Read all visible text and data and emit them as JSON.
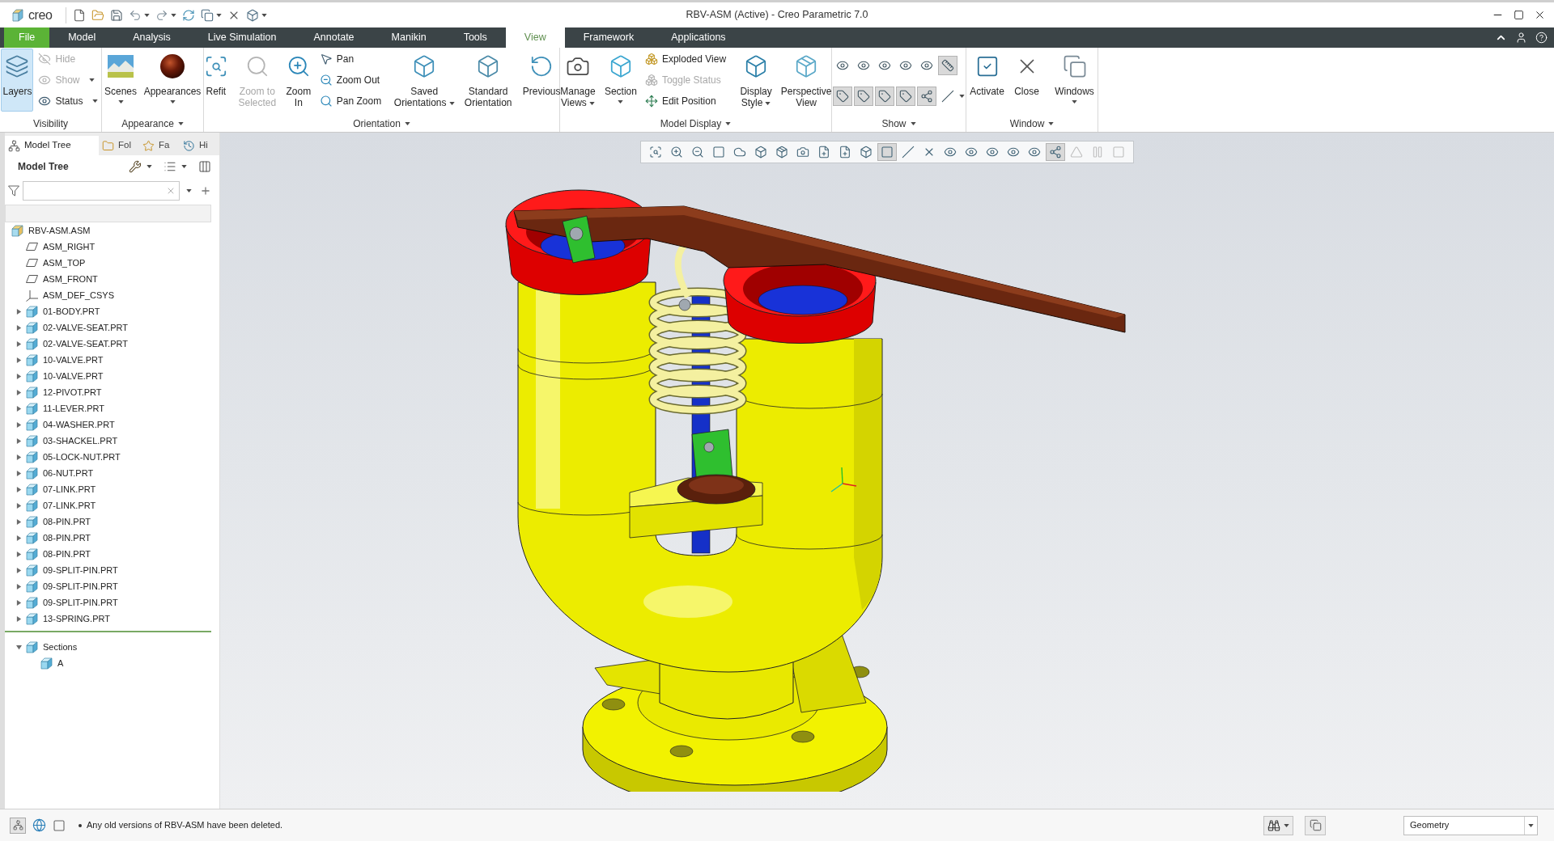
{
  "title_bar": {
    "logo": "creo",
    "title": "RBV-ASM (Active) - Creo Parametric 7.0"
  },
  "ribbon_tabs": [
    {
      "label": "File",
      "kind": "file",
      "selected": false
    },
    {
      "label": "Model",
      "kind": "tab",
      "selected": false
    },
    {
      "label": "Analysis",
      "kind": "tab",
      "selected": false
    },
    {
      "label": "Live Simulation",
      "kind": "tab",
      "selected": false
    },
    {
      "label": "Annotate",
      "kind": "tab",
      "selected": false
    },
    {
      "label": "Manikin",
      "kind": "tab",
      "selected": false
    },
    {
      "label": "Tools",
      "kind": "tab",
      "selected": false
    },
    {
      "label": "View",
      "kind": "tab",
      "selected": true
    },
    {
      "label": "Framework",
      "kind": "tab",
      "selected": false
    },
    {
      "label": "Applications",
      "kind": "tab",
      "selected": false
    }
  ],
  "ribbon_groups": [
    {
      "label": "Visibility",
      "menu": false,
      "buttons": [
        {
          "label": "Layers",
          "kind": "large",
          "on": true,
          "disabled": false,
          "dropdown": false
        },
        {
          "label": "Hide",
          "kind": "small",
          "on": false,
          "disabled": true,
          "dropdown": false
        },
        {
          "label": "Show",
          "kind": "small",
          "on": false,
          "disabled": true,
          "dropdown": true
        },
        {
          "label": "Status",
          "kind": "small",
          "on": false,
          "disabled": false,
          "dropdown": true
        }
      ]
    },
    {
      "label": "Appearance",
      "menu": true,
      "buttons": [
        {
          "label": "Scenes",
          "kind": "large",
          "on": false,
          "disabled": false,
          "dropdown": true
        },
        {
          "label": "Appearances",
          "kind": "large",
          "on": false,
          "disabled": false,
          "dropdown": true
        }
      ]
    },
    {
      "label": "Orientation",
      "menu": true,
      "buttons": [
        {
          "label": "Refit",
          "kind": "large",
          "on": false,
          "disabled": false,
          "dropdown": false
        },
        {
          "label": "Zoom to Selected",
          "kind": "large",
          "on": false,
          "disabled": true,
          "dropdown": false
        },
        {
          "label": "Zoom In",
          "kind": "large",
          "on": false,
          "disabled": false,
          "dropdown": false
        },
        {
          "label": "Pan",
          "kind": "small",
          "on": false,
          "disabled": false,
          "dropdown": false
        },
        {
          "label": "Zoom Out",
          "kind": "small",
          "on": false,
          "disabled": false,
          "dropdown": false
        },
        {
          "label": "Pan Zoom",
          "kind": "small",
          "on": false,
          "disabled": false,
          "dropdown": false
        },
        {
          "label": "Saved Orientations",
          "kind": "large",
          "on": false,
          "disabled": false,
          "dropdown": true
        },
        {
          "label": "Standard Orientation",
          "kind": "large",
          "on": false,
          "disabled": false,
          "dropdown": false
        },
        {
          "label": "Previous",
          "kind": "large",
          "on": false,
          "disabled": false,
          "dropdown": false
        }
      ]
    },
    {
      "label": "Model Display",
      "menu": true,
      "buttons": [
        {
          "label": "Manage Views",
          "kind": "large",
          "on": false,
          "disabled": false,
          "dropdown": true
        },
        {
          "label": "Section",
          "kind": "large",
          "on": false,
          "disabled": false,
          "dropdown": true
        },
        {
          "label": "Exploded View",
          "kind": "small",
          "on": false,
          "disabled": false,
          "dropdown": false
        },
        {
          "label": "Toggle Status",
          "kind": "small",
          "on": false,
          "disabled": true,
          "dropdown": false
        },
        {
          "label": "Edit Position",
          "kind": "small",
          "on": false,
          "disabled": false,
          "dropdown": false
        },
        {
          "label": "Display Style",
          "kind": "large",
          "on": false,
          "disabled": false,
          "dropdown": true
        },
        {
          "label": "Perspective View",
          "kind": "large",
          "on": false,
          "disabled": false,
          "dropdown": false
        }
      ]
    },
    {
      "label": "Show",
      "menu": true,
      "buttons": [
        {
          "kind": "icon",
          "on": false,
          "disabled": false,
          "dropdown": false
        },
        {
          "kind": "icon",
          "on": false,
          "disabled": false,
          "dropdown": false
        },
        {
          "kind": "icon",
          "on": false,
          "disabled": false,
          "dropdown": false
        },
        {
          "kind": "icon",
          "on": false,
          "disabled": false,
          "dropdown": false
        },
        {
          "kind": "icon",
          "on": false,
          "disabled": false,
          "dropdown": false
        },
        {
          "kind": "icon",
          "on": true,
          "disabled": false,
          "dropdown": false
        },
        {
          "kind": "icon",
          "on": true,
          "disabled": false,
          "dropdown": false
        },
        {
          "kind": "icon",
          "on": true,
          "disabled": false,
          "dropdown": false
        },
        {
          "kind": "icon",
          "on": true,
          "disabled": false,
          "dropdown": false
        },
        {
          "kind": "icon",
          "on": true,
          "disabled": false,
          "dropdown": false
        },
        {
          "kind": "icon",
          "on": true,
          "disabled": false,
          "dropdown": false
        },
        {
          "kind": "icon",
          "on": false,
          "disabled": false,
          "dropdown": true
        }
      ]
    },
    {
      "label": "Window",
      "menu": true,
      "buttons": [
        {
          "label": "Activate",
          "kind": "large",
          "on": false,
          "disabled": false,
          "dropdown": false
        },
        {
          "label": "Close",
          "kind": "large",
          "on": false,
          "disabled": false,
          "dropdown": false
        },
        {
          "label": "Windows",
          "kind": "large",
          "on": false,
          "disabled": false,
          "dropdown": true
        }
      ]
    }
  ],
  "model_tree": {
    "tabs": [
      {
        "label": "Model Tree",
        "selected": true
      },
      {
        "label": "Fol",
        "selected": false
      },
      {
        "label": "Fa",
        "selected": false
      },
      {
        "label": "Hi",
        "selected": false
      }
    ],
    "title": "Model Tree",
    "items": [
      {
        "label": "RBV-ASM.ASM",
        "kind": "assembly",
        "children": [
          {
            "label": "ASM_RIGHT",
            "kind": "plane"
          },
          {
            "label": "ASM_TOP",
            "kind": "plane"
          },
          {
            "label": "ASM_FRONT",
            "kind": "plane"
          },
          {
            "label": "ASM_DEF_CSYS",
            "kind": "csys"
          },
          {
            "label": "01-BODY.PRT",
            "kind": "part",
            "expanded": false
          },
          {
            "label": "02-VALVE-SEAT.PRT",
            "kind": "part",
            "expanded": false
          },
          {
            "label": "02-VALVE-SEAT.PRT",
            "kind": "part",
            "expanded": false
          },
          {
            "label": "10-VALVE.PRT",
            "kind": "part",
            "expanded": false
          },
          {
            "label": "10-VALVE.PRT",
            "kind": "part",
            "expanded": false
          },
          {
            "label": "12-PIVOT.PRT",
            "kind": "part",
            "expanded": false
          },
          {
            "label": "11-LEVER.PRT",
            "kind": "part",
            "expanded": false
          },
          {
            "label": "04-WASHER.PRT",
            "kind": "part",
            "expanded": false
          },
          {
            "label": "03-SHACKEL.PRT",
            "kind": "part",
            "expanded": false
          },
          {
            "label": "05-LOCK-NUT.PRT",
            "kind": "part",
            "expanded": false
          },
          {
            "label": "06-NUT.PRT",
            "kind": "part",
            "expanded": false
          },
          {
            "label": "07-LINK.PRT",
            "kind": "part",
            "expanded": false
          },
          {
            "label": "07-LINK.PRT",
            "kind": "part",
            "expanded": false
          },
          {
            "label": "08-PIN.PRT",
            "kind": "part",
            "expanded": false
          },
          {
            "label": "08-PIN.PRT",
            "kind": "part",
            "expanded": false
          },
          {
            "label": "08-PIN.PRT",
            "kind": "part",
            "expanded": false
          },
          {
            "label": "09-SPLIT-PIN.PRT",
            "kind": "part",
            "expanded": false
          },
          {
            "label": "09-SPLIT-PIN.PRT",
            "kind": "part",
            "expanded": false
          },
          {
            "label": "09-SPLIT-PIN.PRT",
            "kind": "part",
            "expanded": false
          },
          {
            "label": "13-SPRING.PRT",
            "kind": "part",
            "expanded": false
          }
        ]
      }
    ],
    "sections": [
      {
        "label": "Sections",
        "kind": "folder",
        "expanded": true,
        "children": [
          {
            "label": "A",
            "kind": "section"
          }
        ]
      }
    ]
  },
  "viewport": {
    "toolbar": [
      {
        "on": false,
        "disabled": false
      },
      {
        "on": false,
        "disabled": false
      },
      {
        "on": false,
        "disabled": false
      },
      {
        "on": false,
        "disabled": false
      },
      {
        "on": false,
        "disabled": false
      },
      {
        "on": false,
        "disabled": false
      },
      {
        "on": false,
        "disabled": false
      },
      {
        "on": false,
        "disabled": false
      },
      {
        "on": false,
        "disabled": false
      },
      {
        "on": false,
        "disabled": false
      },
      {
        "on": false,
        "disabled": false
      },
      {
        "on": true,
        "disabled": false
      },
      {
        "on": false,
        "disabled": false
      },
      {
        "on": false,
        "disabled": false
      },
      {
        "on": false,
        "disabled": false
      },
      {
        "on": false,
        "disabled": false
      },
      {
        "on": false,
        "disabled": false
      },
      {
        "on": false,
        "disabled": false
      },
      {
        "on": false,
        "disabled": false
      },
      {
        "on": true,
        "disabled": false
      },
      {
        "on": false,
        "disabled": true
      },
      {
        "on": false,
        "disabled": true
      },
      {
        "on": false,
        "disabled": true
      }
    ]
  },
  "status_bar": {
    "message": "Any old versions of RBV-ASM have been deleted.",
    "selection_filter": "Geometry"
  }
}
